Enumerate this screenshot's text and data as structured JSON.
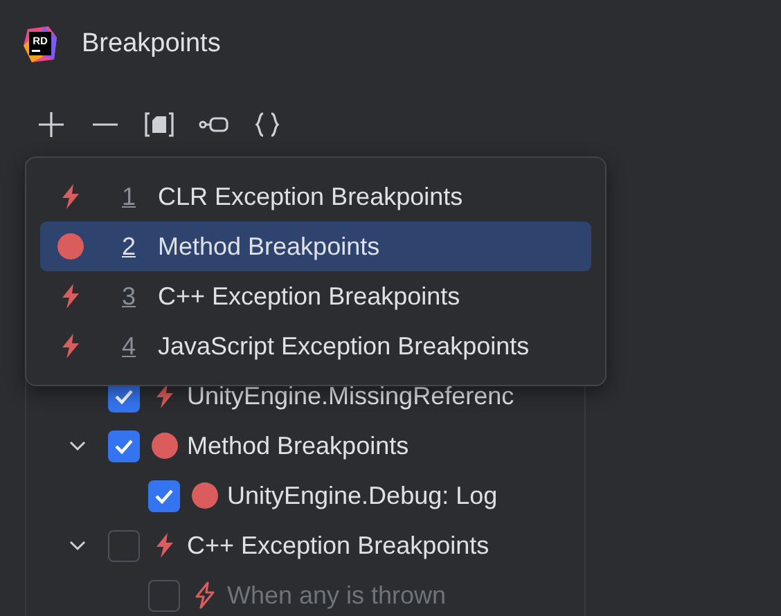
{
  "window": {
    "logo_text": "RD",
    "title": "Breakpoints"
  },
  "toolbar": [
    {
      "kind": "add"
    },
    {
      "kind": "remove"
    },
    {
      "kind": "file"
    },
    {
      "kind": "toggle"
    },
    {
      "kind": "braces"
    }
  ],
  "tree": [
    {
      "children": [
        {
          "kind": "exception",
          "label": "UnityEngine.MissingReferenc",
          "checked": true,
          "disabled": false
        }
      ]
    },
    {
      "kind": "method",
      "label": "Method Breakpoints",
      "checked": true,
      "expanded": true,
      "disabled": false,
      "children": [
        {
          "kind": "method",
          "label": "UnityEngine.Debug: Log",
          "checked": true,
          "disabled": false
        }
      ]
    },
    {
      "kind": "exception",
      "label": "C++ Exception Breakpoints",
      "checked": false,
      "expanded": true,
      "disabled": false,
      "children": [
        {
          "kind": "exception",
          "label": "When any is thrown",
          "checked": false,
          "disabled": true
        }
      ]
    }
  ],
  "popup": {
    "items": [
      {
        "kind": "exception",
        "number": "1",
        "label": "CLR Exception Breakpoints",
        "selected": false
      },
      {
        "kind": "method",
        "number": "2",
        "label": "Method Breakpoints",
        "selected": true
      },
      {
        "kind": "exception",
        "number": "3",
        "label": "C++ Exception Breakpoints",
        "selected": false
      },
      {
        "kind": "exception",
        "number": "4",
        "label": "JavaScript Exception Breakpoints",
        "selected": false
      }
    ]
  }
}
